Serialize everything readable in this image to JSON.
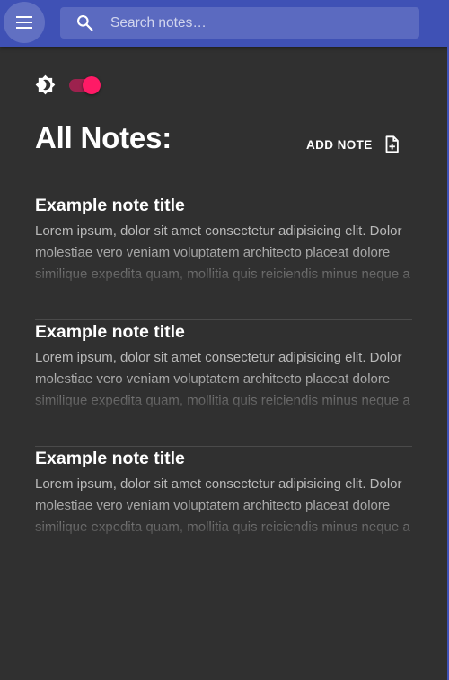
{
  "header": {
    "search_placeholder": "Search notes…",
    "accent_color": "#3f51b5"
  },
  "theme": {
    "icon": "brightness-icon",
    "dark_mode_on": true,
    "toggle_color": "#ff1a66"
  },
  "main": {
    "title": "All Notes:",
    "add_note_label": "ADD NOTE",
    "notes": [
      {
        "title": "Example note title",
        "body": "Lorem ipsum, dolor sit amet consectetur adipisicing elit. Dolor molestiae vero veniam voluptatem architecto placeat dolore similique expedita quam, mollitia quis reiciendis minus neque a"
      },
      {
        "title": "Example note title",
        "body": "Lorem ipsum, dolor sit amet consectetur adipisicing elit. Dolor molestiae vero veniam voluptatem architecto placeat dolore similique expedita quam, mollitia quis reiciendis minus neque a"
      },
      {
        "title": "Example note title",
        "body": "Lorem ipsum, dolor sit amet consectetur adipisicing elit. Dolor molestiae vero veniam voluptatem architecto placeat dolore similique expedita quam, mollitia quis reiciendis minus neque a"
      }
    ]
  }
}
